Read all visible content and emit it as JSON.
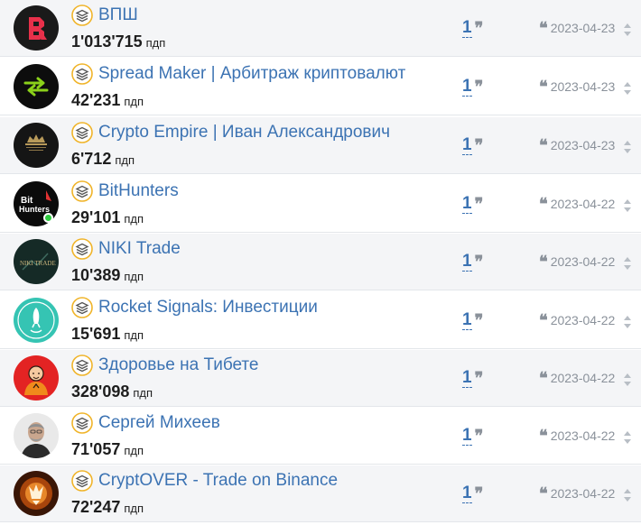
{
  "channels": [
    {
      "name": "ВПШ",
      "subscribers": "1'013'715",
      "unit": "пдп",
      "mentions": "1",
      "date": "2023-04-23",
      "avatar": "vpsh-logo"
    },
    {
      "name": "Spread Maker | Арбитраж криптовалют",
      "subscribers": "42'231",
      "unit": "пдп",
      "mentions": "1",
      "date": "2023-04-23",
      "avatar": "spread-maker-logo"
    },
    {
      "name": "Crypto Empire | Иван Александрович",
      "subscribers": "6'712",
      "unit": "пдп",
      "mentions": "1",
      "date": "2023-04-23",
      "avatar": "crypto-empire-logo"
    },
    {
      "name": "BitHunters",
      "subscribers": "29'101",
      "unit": "пдп",
      "mentions": "1",
      "date": "2023-04-22",
      "avatar": "bithunters-logo",
      "avatar_text": "Bit Hunters",
      "online": true
    },
    {
      "name": "NIKI Trade",
      "subscribers": "10'389",
      "unit": "пдп",
      "mentions": "1",
      "date": "2023-04-22",
      "avatar": "niki-trade-logo",
      "avatar_text": "NIKI TRADE"
    },
    {
      "name": "Rocket Signals: Инвестиции",
      "subscribers": "15'691",
      "unit": "пдп",
      "mentions": "1",
      "date": "2023-04-22",
      "avatar": "rocket-signals-logo"
    },
    {
      "name": "Здоровье на Тибете",
      "subscribers": "328'098",
      "unit": "пдп",
      "mentions": "1",
      "date": "2023-04-22",
      "avatar": "monk-avatar"
    },
    {
      "name": "Сергей Михеев",
      "subscribers": "71'057",
      "unit": "пдп",
      "mentions": "1",
      "date": "2023-04-22",
      "avatar": "person-photo"
    },
    {
      "name": "CryptOVER - Trade on Binance",
      "subscribers": "72'247",
      "unit": "пдп",
      "mentions": "1",
      "date": "2023-04-22",
      "avatar": "cryptover-logo"
    }
  ],
  "icons": {
    "channel_type": "layers-icon",
    "mention": "quote-icon",
    "date": "quote-icon",
    "scroll": "spinner-arrows-icon"
  },
  "colors": {
    "link": "#3c73b3",
    "badge": "#f0b429",
    "muted": "#8a919a",
    "online": "#2ecc40"
  }
}
